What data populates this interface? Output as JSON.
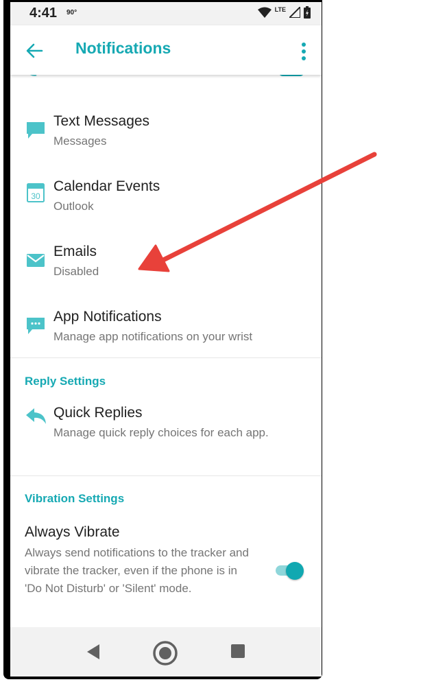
{
  "status_bar": {
    "time": "4:41",
    "temperature": "90°",
    "network": "LTE",
    "icons": [
      "wifi-icon",
      "signal-icon",
      "battery-icon"
    ]
  },
  "app_bar": {
    "title": "Notifications",
    "icons": [
      "back-arrow-icon",
      "more-vert-icon"
    ]
  },
  "notification_items": [
    {
      "title": "Text Messages",
      "subtitle": "Messages",
      "icon": "chat-bubble-icon"
    },
    {
      "title": "Calendar Events",
      "subtitle": "Outlook",
      "icon": "calendar-icon",
      "icon_text": "30"
    },
    {
      "title": "Emails",
      "subtitle": "Disabled",
      "icon": "envelope-icon"
    },
    {
      "title": "App Notifications",
      "subtitle": "Manage app notifications on your wrist",
      "icon": "app-chat-icon"
    }
  ],
  "reply_settings": {
    "heading": "Reply Settings",
    "quick_replies": {
      "title": "Quick Replies",
      "subtitle": "Manage quick reply choices for each app.",
      "icon": "reply-icon"
    }
  },
  "vibration_settings": {
    "heading": "Vibration Settings",
    "always_vibrate": {
      "title": "Always Vibrate",
      "description": "Always send notifications to the tracker and vibrate the tracker, even if the phone is in 'Do Not Disturb' or 'Silent' mode.",
      "enabled": true
    }
  },
  "nav_bar": {
    "icons": [
      "nav-back-icon",
      "nav-home-icon",
      "nav-recents-icon"
    ]
  },
  "colors": {
    "accent": "#16a9b3",
    "icon": "#4cc3c9",
    "annotation_arrow": "#e8413a"
  }
}
